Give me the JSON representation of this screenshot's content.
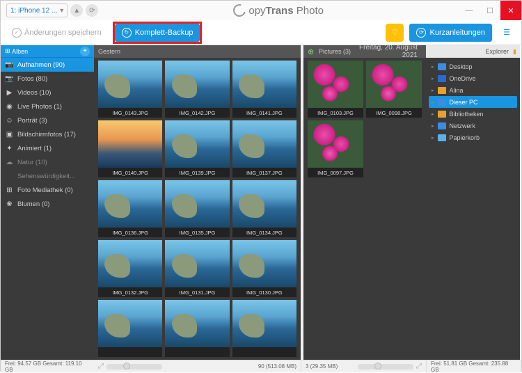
{
  "titlebar": {
    "device": "1: iPhone 12 ...",
    "app_prefix": "opy",
    "app_mid": "Trans",
    "app_suffix": "Photo"
  },
  "toolbar": {
    "save": "Änderungen speichern",
    "backup": "Komplett-Backup",
    "guide": "Kurzanleitungen"
  },
  "sidebar": {
    "tab": "Alben",
    "items": [
      {
        "ic": "📷",
        "t": "Aufnahmen (90)",
        "act": true
      },
      {
        "ic": "📷",
        "t": "Fotos (80)"
      },
      {
        "ic": "▶",
        "t": "Videos (10)"
      },
      {
        "ic": "◉",
        "t": "Live Photos (1)"
      },
      {
        "ic": "☺",
        "t": "Porträt (3)"
      },
      {
        "ic": "▣",
        "t": "Bildschirmfotos (17)"
      },
      {
        "ic": "✦",
        "t": "Animiert (1)"
      },
      {
        "ic": "☁",
        "t": "Natur (10)",
        "dim": true
      },
      {
        "ic": "",
        "t": "Sehenswürdigkeit...",
        "dim": true
      },
      {
        "ic": "⊞",
        "t": "Foto Mediathek (0)"
      },
      {
        "ic": "❀",
        "t": "Blumen (0)"
      }
    ]
  },
  "left": {
    "header": "Gestern",
    "thumbs": [
      {
        "n": "IMG_0143.JPG",
        "c": "sea"
      },
      {
        "n": "IMG_0142.JPG",
        "c": "sea"
      },
      {
        "n": "IMG_0141.JPG",
        "c": "sea"
      },
      {
        "n": "IMG_0140.JPG",
        "c": "sun"
      },
      {
        "n": "IMG_0139.JPG",
        "c": "sea"
      },
      {
        "n": "IMG_0137.JPG",
        "c": "sea"
      },
      {
        "n": "IMG_0136.JPG",
        "c": "sea"
      },
      {
        "n": "IMG_0135.JPG",
        "c": "sea"
      },
      {
        "n": "IMG_0134.JPG",
        "c": "sea"
      },
      {
        "n": "IMG_0132.JPG",
        "c": "sea"
      },
      {
        "n": "IMG_0131.JPG",
        "c": "sea"
      },
      {
        "n": "IMG_0130.JPG",
        "c": "sea"
      },
      {
        "n": "",
        "c": "sea"
      },
      {
        "n": "",
        "c": "sea"
      },
      {
        "n": "",
        "c": "sea"
      }
    ]
  },
  "mid": {
    "header": "Pictures (3)",
    "date": "Freitag, 20. August 2021",
    "thumbs": [
      {
        "n": "IMG_0103.JPG",
        "c": "flw"
      },
      {
        "n": "IMG_0098.JPG",
        "c": "flw"
      },
      {
        "n": "IMG_0097.JPG",
        "c": "flw"
      }
    ]
  },
  "explorer": {
    "tab": "Explorer",
    "tree": [
      {
        "ic": "#3a8de0",
        "t": "Desktop"
      },
      {
        "ic": "#2a6acc",
        "t": "OneDrive"
      },
      {
        "ic": "#e8a030",
        "t": "Alina"
      },
      {
        "ic": "#3a8de0",
        "t": "Dieser PC",
        "sel": true
      },
      {
        "ic": "#e8a030",
        "t": "Bibliotheken"
      },
      {
        "ic": "#3a8de0",
        "t": "Netzwerk"
      },
      {
        "ic": "#5ab0e8",
        "t": "Papierkorb"
      }
    ]
  },
  "status": {
    "s1": "Frei: 94.57 GB Gesamt: 119.10 GB",
    "s2": "90 (513.08 MB)",
    "s3": "3 (29.35 MB)",
    "s4": "Frei: 51.81 GB Gesamt: 235.88 GB"
  }
}
